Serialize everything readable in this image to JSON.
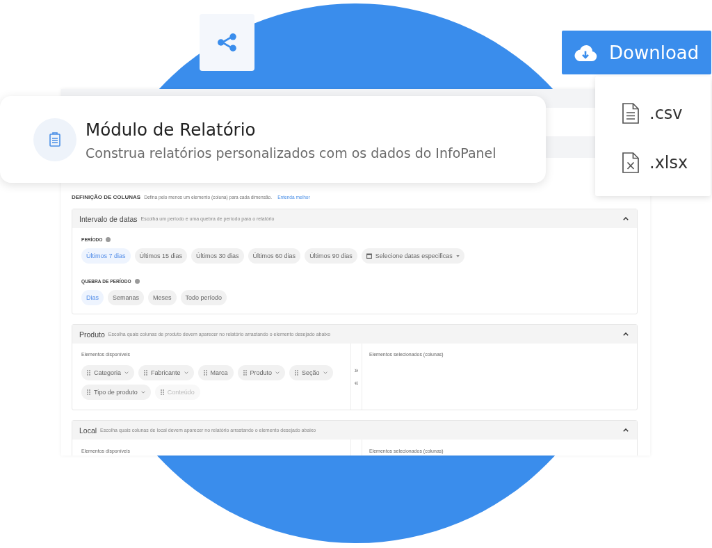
{
  "download": {
    "label": "Download",
    "options": [
      {
        "label": ".csv",
        "kind": "text"
      },
      {
        "label": ".xlsx",
        "kind": "spreadsheet"
      }
    ]
  },
  "header_card": {
    "title": "Módulo de Relatório",
    "subtitle": "Construa relatórios personalizados com os dados do InfoPanel"
  },
  "columns_definition": {
    "title": "DEFINIÇÃO DE COLUNAS",
    "description": "Defina pelo menos um elemento (coluna) para cada dimensão.",
    "link": "Entenda melhor"
  },
  "sections": [
    {
      "kind": "dates",
      "title": "Intervalo de datas",
      "description": "Escolha um período e uma quebra de período para o relatório",
      "expanded": true,
      "groups": [
        {
          "label": "PERÍODO",
          "options": [
            {
              "label": "Últimos 7 dias",
              "kind": "preset",
              "selected": true
            },
            {
              "label": "Últimos 15 dias",
              "kind": "preset",
              "selected": false
            },
            {
              "label": "Últimos 30 dias",
              "kind": "preset",
              "selected": false
            },
            {
              "label": "Últimos 60 dias",
              "kind": "preset",
              "selected": false
            },
            {
              "label": "Últimos 90 dias",
              "kind": "preset",
              "selected": false
            },
            {
              "label": "Selecione datas especificas",
              "kind": "date_picker",
              "selected": false
            }
          ]
        },
        {
          "label": "QUEBRA DE PERÍODO",
          "options": [
            {
              "label": "Dias",
              "kind": "preset",
              "selected": true
            },
            {
              "label": "Semanas",
              "kind": "preset",
              "selected": false
            },
            {
              "label": "Meses",
              "kind": "preset",
              "selected": false
            },
            {
              "label": "Todo período",
              "kind": "preset",
              "selected": false
            }
          ]
        }
      ]
    },
    {
      "kind": "columns",
      "title": "Produto",
      "description": "Escolha quais colunas de produto devem aparecer no relatório arrastando o elemento desejado abaixo",
      "expanded": true,
      "available_label": "Elementos disponíveis",
      "move_right": "»",
      "move_left": "«",
      "selected_label": "Elementos selecionados (colunas)",
      "elements": [
        {
          "label": "Categoria",
          "has_menu": true,
          "disabled": false
        },
        {
          "label": "Fabricante",
          "has_menu": true,
          "disabled": false
        },
        {
          "label": "Marca",
          "has_menu": false,
          "disabled": false
        },
        {
          "label": "Produto",
          "has_menu": true,
          "disabled": false
        },
        {
          "label": "Seção",
          "has_menu": true,
          "disabled": false
        },
        {
          "label": "Tipo de produto",
          "has_menu": true,
          "disabled": false
        },
        {
          "label": "Conteúdo",
          "has_menu": false,
          "disabled": true
        }
      ]
    },
    {
      "kind": "columns",
      "title": "Local",
      "description": "Escolha quais colunas de local devem aparecer no relatório arrastando o elemento desejado abaixo",
      "expanded": true,
      "available_label": "Elementos disponíveis",
      "selected_label": "Elementos selecionados (colunas)"
    }
  ]
}
